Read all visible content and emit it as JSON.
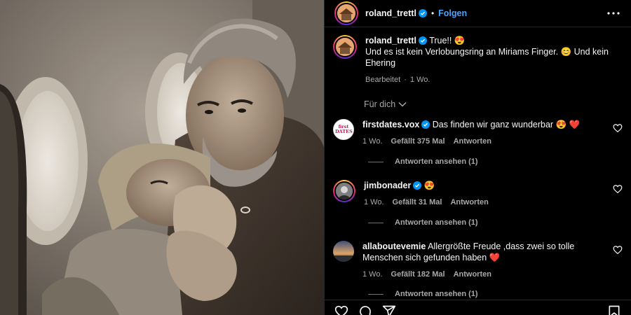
{
  "header": {
    "username": "roland_trettl",
    "separator": "•",
    "follow_label": "Folgen"
  },
  "caption": {
    "username": "roland_trettl",
    "line1": "True!! 😍",
    "line2": "Und es ist kein Verlobungsring an Miriams Finger. 😊 Und kein Ehering",
    "edited": "Bearbeitet",
    "separator": "·",
    "age": "1 Wo."
  },
  "filter": {
    "label": "Für dich"
  },
  "comments": [
    {
      "username": "firstdates.vox",
      "text": "Das finden wir ganz wunderbar 😍 ❤️",
      "age": "1 Wo.",
      "likes": "Gefällt 375 Mal",
      "reply": "Antworten",
      "view_replies": "Antworten ansehen (1)",
      "avatar_text": "first DATES"
    },
    {
      "username": "jimbonader",
      "text": "😍",
      "age": "1 Wo.",
      "likes": "Gefällt 31 Mal",
      "reply": "Antworten",
      "view_replies": "Antworten ansehen (1)"
    },
    {
      "username": "allaboutevemie",
      "text": "Allergrößte Freude ,dass zwei so tolle Menschen sich gefunden haben ❤️",
      "age": "1 Wo.",
      "likes": "Gefällt 182 Mal",
      "reply": "Antworten",
      "view_replies": "Antworten ansehen (1)"
    }
  ],
  "colors": {
    "background": "#000000",
    "text": "#f5f5f5",
    "muted": "#a8a8a8",
    "link": "#4fa3f7",
    "verified": "#0095f6",
    "divider": "#262626"
  },
  "icons": {
    "more": "more-horizontal-icon",
    "verified": "verified-badge-icon",
    "heart": "heart-outline-icon",
    "chevron": "chevron-down-icon",
    "comment": "comment-icon",
    "share": "share-icon",
    "save": "bookmark-icon"
  }
}
